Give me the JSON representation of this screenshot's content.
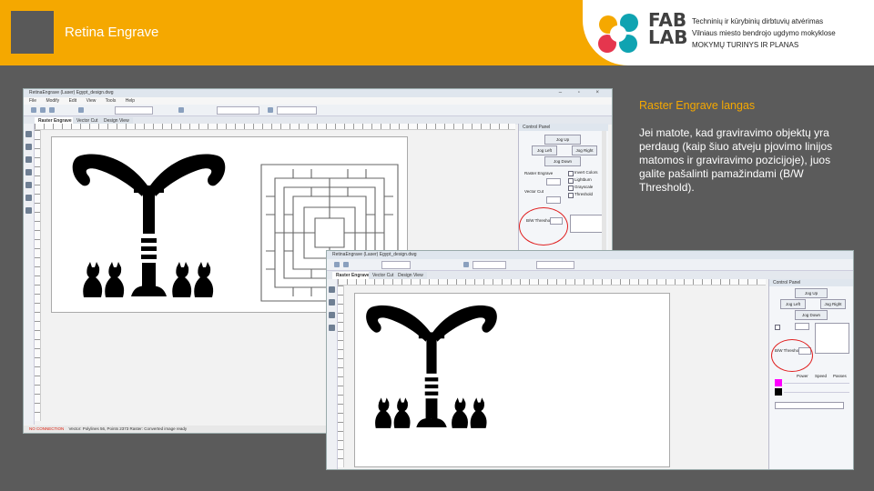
{
  "header": {
    "title": "Retina Engrave",
    "logo_text_top": "FAB",
    "logo_text_bottom": "LAB",
    "lines": [
      "Techninių ir kūrybinių dirbtuvių atvėrimas",
      "Vilniaus miesto bendrojo ugdymo mokyklose",
      "MOKYMŲ TURINYS IR PLANAS"
    ],
    "colors": {
      "accent": "#f5a800",
      "dark": "#595959",
      "logo_text": "#404040"
    }
  },
  "caption": {
    "title": "Raster Engrave langas",
    "body": "Jei matote, kad graviravimo objektų yra perdaug (kaip šiuo atveju pjovimo linijos matomos ir graviravimo pozicijoje), juos galite pašalinti pamažindami (B/W Threshold)."
  },
  "window1": {
    "title": "RetinaEngrave (Laser)  Egypt_design.dwg",
    "menu": [
      "File",
      "Modify",
      "Edit",
      "View",
      "Tools",
      "Help"
    ],
    "tabs": [
      "Raster Engrave",
      "Vector Cut",
      "Design View"
    ],
    "panel": {
      "title": "Control Panel",
      "buttons": [
        "Jog Up",
        "Jog Left",
        "Jog Right",
        "Jog Down"
      ],
      "labels": [
        "Raster Engrave",
        "Vector Cut",
        "B/W Threshold",
        "Power",
        "Speed",
        "Passes"
      ],
      "checkboxes": [
        "Invert Colors",
        "Lightburn",
        "Grayscale",
        "Threshold"
      ]
    },
    "status": {
      "error": "NO CONNECTION",
      "text": "Vector: Polylines 56, Points 2373   Raster: Converted image ready"
    }
  },
  "window2": {
    "title": "RetinaEngrave (Laser)  Egypt_design.dwg",
    "tabs": [
      "Raster Engrave",
      "Vector Cut",
      "Design View"
    ],
    "panel": {
      "title": "Control Panel",
      "buttons": [
        "Jog Up",
        "Jog Left",
        "Jog Right",
        "Jog Down"
      ],
      "labels": [
        "B/W Threshold",
        "Power",
        "Speed",
        "Passes"
      ]
    }
  },
  "swatch_colors": [
    "#ff00ff",
    "#000000"
  ]
}
